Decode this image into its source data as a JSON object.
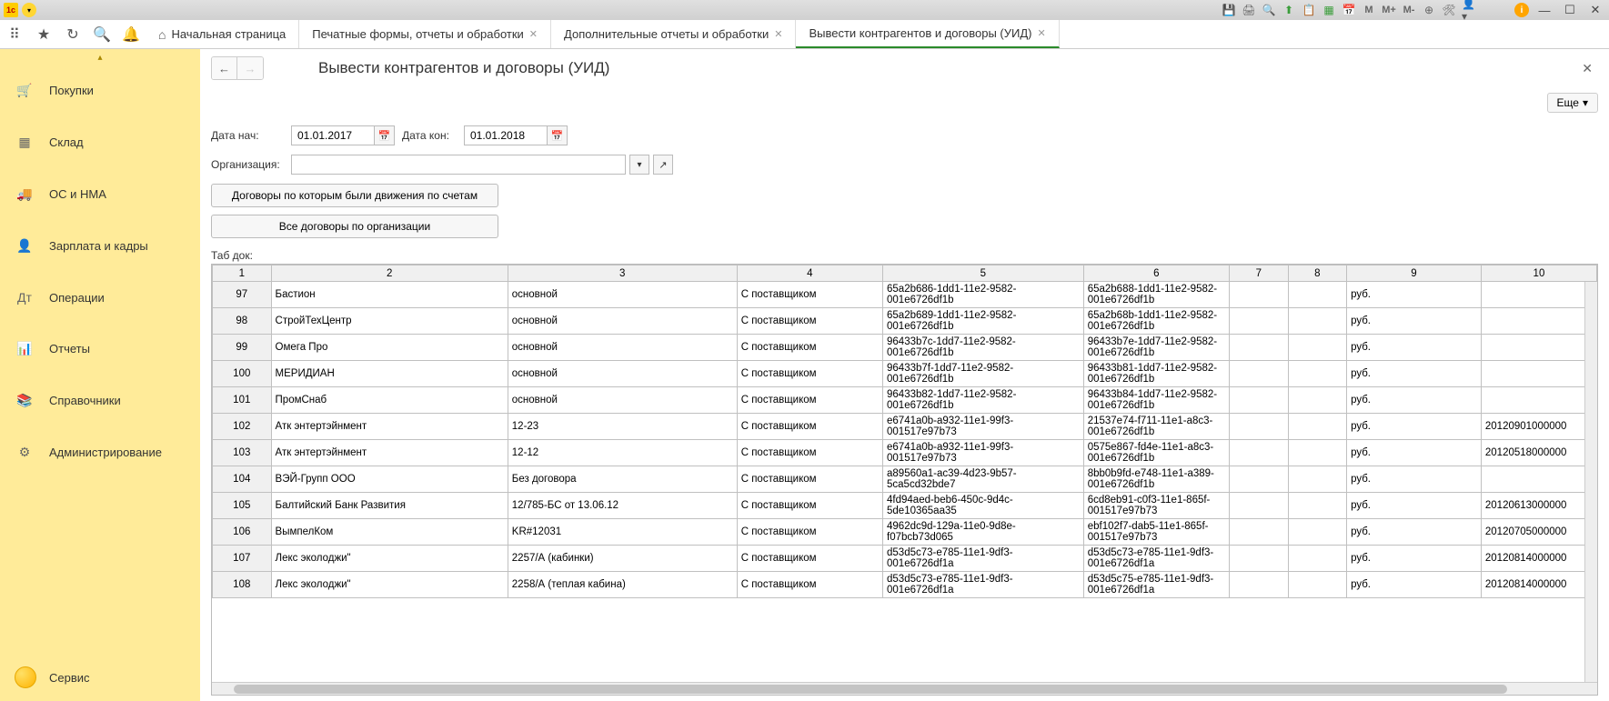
{
  "titlebar": {
    "m_labels": [
      "M",
      "M+",
      "M-"
    ]
  },
  "tabs": {
    "home": "Начальная страница",
    "items": [
      {
        "label": "Печатные формы, отчеты и обработки",
        "closable": true,
        "active": false
      },
      {
        "label": "Дополнительные отчеты и обработки",
        "closable": true,
        "active": false
      },
      {
        "label": "Вывести контрагентов и договоры (УИД)",
        "closable": true,
        "active": true
      }
    ]
  },
  "sidebar": {
    "items": [
      {
        "icon": "cart",
        "label": "Покупки"
      },
      {
        "icon": "grid",
        "label": "Склад"
      },
      {
        "icon": "truck",
        "label": "ОС и НМА"
      },
      {
        "icon": "person",
        "label": "Зарплата и кадры"
      },
      {
        "icon": "ops",
        "label": "Операции"
      },
      {
        "icon": "chart",
        "label": "Отчеты"
      },
      {
        "icon": "book",
        "label": "Справочники"
      },
      {
        "icon": "gear",
        "label": "Администрирование"
      }
    ],
    "service": "Сервис"
  },
  "page": {
    "title": "Вывести контрагентов и договоры (УИД)",
    "more_label": "Еще"
  },
  "form": {
    "date_start_label": "Дата нач:",
    "date_start": "01.01.2017",
    "date_end_label": "Дата кон:",
    "date_end": "01.01.2018",
    "org_label": "Организация:",
    "org_value": "",
    "btn1": "Договоры по которым были движения по счетам",
    "btn2": "Все договоры по организации",
    "tab_doc": "Таб док:"
  },
  "table": {
    "columns": [
      "1",
      "2",
      "3",
      "4",
      "5",
      "6",
      "7",
      "8",
      "9",
      "10"
    ],
    "rows": [
      {
        "n": "97",
        "cells": [
          "Бастион",
          "основной",
          "С поставщиком",
          "65a2b686-1dd1-11e2-9582-001e6726df1b",
          "65a2b688-1dd1-11e2-9582-001e6726df1b",
          "",
          "",
          "руб.",
          ""
        ]
      },
      {
        "n": "98",
        "cells": [
          "СтройТехЦентр",
          "основной",
          "С поставщиком",
          "65a2b689-1dd1-11e2-9582-001e6726df1b",
          "65a2b68b-1dd1-11e2-9582-001e6726df1b",
          "",
          "",
          "руб.",
          ""
        ]
      },
      {
        "n": "99",
        "cells": [
          "Омега Про",
          "основной",
          "С поставщиком",
          "96433b7c-1dd7-11e2-9582-001e6726df1b",
          "96433b7e-1dd7-11e2-9582-001e6726df1b",
          "",
          "",
          "руб.",
          ""
        ]
      },
      {
        "n": "100",
        "cells": [
          "МЕРИДИАН",
          "основной",
          "С поставщиком",
          "96433b7f-1dd7-11e2-9582-001e6726df1b",
          "96433b81-1dd7-11e2-9582-001e6726df1b",
          "",
          "",
          "руб.",
          ""
        ]
      },
      {
        "n": "101",
        "cells": [
          "ПромСнаб",
          "основной",
          "С поставщиком",
          "96433b82-1dd7-11e2-9582-001e6726df1b",
          "96433b84-1dd7-11e2-9582-001e6726df1b",
          "",
          "",
          "руб.",
          ""
        ]
      },
      {
        "n": "102",
        "cells": [
          "Атк энтертэйнмент",
          "12-23",
          "С поставщиком",
          "e6741a0b-a932-11e1-99f3-001517e97b73",
          "21537e74-f711-11e1-a8c3-001e6726df1b",
          "",
          "",
          "руб.",
          "20120901000000"
        ]
      },
      {
        "n": "103",
        "cells": [
          "Атк энтертэйнмент",
          "12-12",
          "С поставщиком",
          "e6741a0b-a932-11e1-99f3-001517e97b73",
          "0575e867-fd4e-11e1-a8c3-001e6726df1b",
          "",
          "",
          "руб.",
          "20120518000000"
        ]
      },
      {
        "n": "104",
        "cells": [
          "ВЭЙ-Групп ООО",
          "Без договора",
          "С поставщиком",
          "a89560a1-ac39-4d23-9b57-5ca5cd32bde7",
          "8bb0b9fd-e748-11e1-a389-001e6726df1b",
          "",
          "",
          "руб.",
          ""
        ]
      },
      {
        "n": "105",
        "cells": [
          "Балтийский Банк Развития",
          "12/785-БС от 13.06.12",
          "С поставщиком",
          "4fd94aed-beb6-450c-9d4c-5de10365aa35",
          "6cd8eb91-c0f3-11e1-865f-001517e97b73",
          "",
          "",
          "руб.",
          "20120613000000"
        ]
      },
      {
        "n": "106",
        "cells": [
          "ВымпелКом",
          "KR#12031",
          "С поставщиком",
          "4962dc9d-129a-11e0-9d8e-f07bcb73d065",
          "ebf102f7-dab5-11e1-865f-001517e97b73",
          "",
          "",
          "руб.",
          "20120705000000"
        ]
      },
      {
        "n": "107",
        "cells": [
          "Лекс эколоджи\"",
          "2257/А (кабинки)",
          "С поставщиком",
          "d53d5c73-e785-11e1-9df3-001e6726df1a",
          "d53d5c73-e785-11e1-9df3-001e6726df1a",
          "",
          "",
          "руб.",
          "20120814000000"
        ]
      },
      {
        "n": "108",
        "cells": [
          "Лекс эколоджи\"",
          "2258/А (теплая кабина)",
          "С поставщиком",
          "d53d5c73-e785-11e1-9df3-001e6726df1a",
          "d53d5c75-e785-11e1-9df3-001e6726df1a",
          "",
          "",
          "руб.",
          "20120814000000"
        ]
      }
    ]
  }
}
